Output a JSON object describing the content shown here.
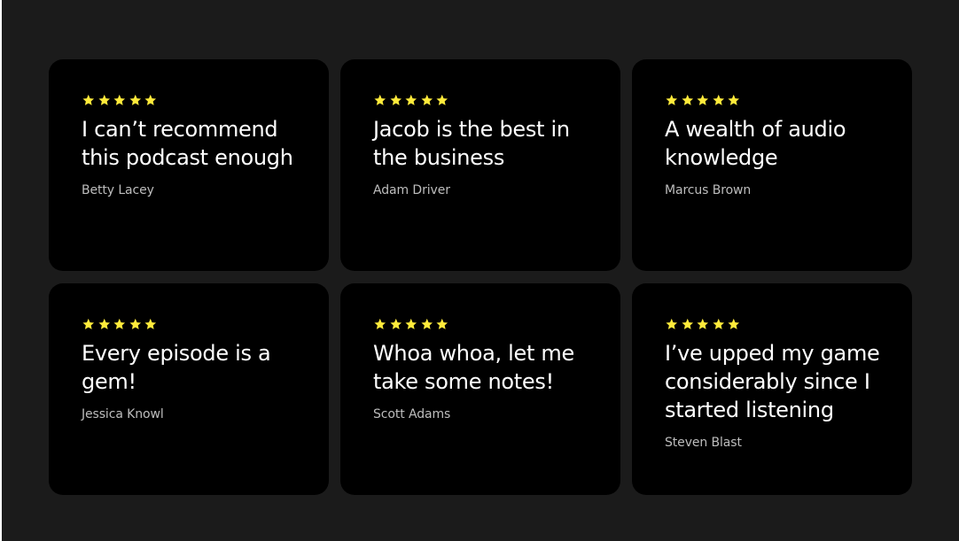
{
  "colors": {
    "page_background": "#1b1b1b",
    "card_background": "#000000",
    "star": "#ffeb3b",
    "quote_text": "#ffffff",
    "author_text": "#bdbdbd"
  },
  "testimonials": [
    {
      "rating": 5,
      "quote": "I can’t recommend this podcast enough",
      "author": "Betty Lacey"
    },
    {
      "rating": 5,
      "quote": "Jacob is the best in the business",
      "author": "Adam Driver"
    },
    {
      "rating": 5,
      "quote": "A wealth of audio knowledge",
      "author": "Marcus Brown"
    },
    {
      "rating": 5,
      "quote": "Every episode is a gem!",
      "author": "Jessica Knowl"
    },
    {
      "rating": 5,
      "quote": "Whoa whoa, let me take some notes!",
      "author": "Scott Adams"
    },
    {
      "rating": 5,
      "quote": "I’ve upped my game considerably since I started listening",
      "author": "Steven Blast"
    }
  ]
}
